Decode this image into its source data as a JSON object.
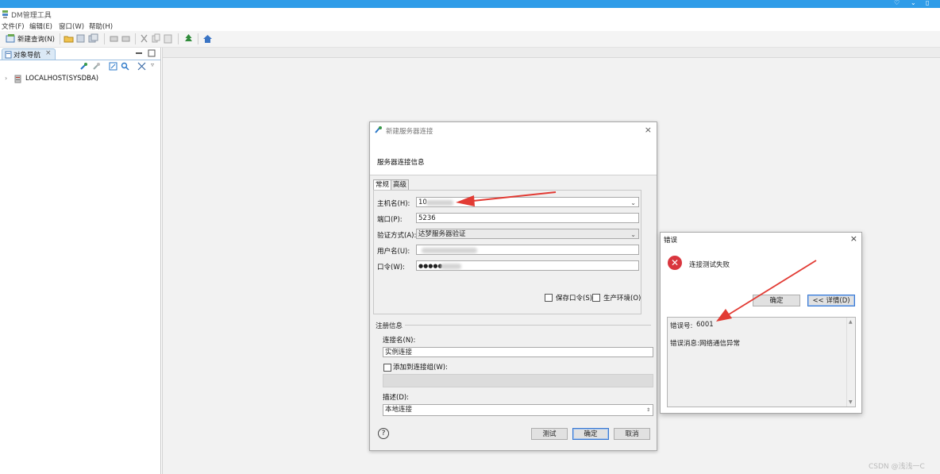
{
  "app": {
    "title": "DM管理工具"
  },
  "menu": [
    "文件(F)",
    "编辑(E)",
    "窗口(W)",
    "帮助(H)"
  ],
  "toolbar": {
    "new_query_label": "新建查询(N)"
  },
  "navigator": {
    "tab_label": "对象导航",
    "tree": [
      {
        "label": "LOCALHOST(SYSDBA)"
      }
    ]
  },
  "connect_dialog": {
    "title": "新建服务器连接",
    "header": "服务器连接信息",
    "tabs": [
      "常规",
      "高级"
    ],
    "host_label": "主机名(H):",
    "host_value": "10",
    "port_label": "端口(P):",
    "port_value": "5236",
    "auth_label": "验证方式(A):",
    "auth_value": "达梦服务器验证",
    "user_label": "用户名(U):",
    "password_label": "口令(W):",
    "password_value": "●●●●●",
    "save_password_label": "保存口令(S)",
    "production_label": "生产环境(O)",
    "reg_group_label": "注册信息",
    "conn_name_label": "连接名(N):",
    "conn_name_value": "实例连接",
    "add_group_label": "添加到连接组(W):",
    "desc_label": "描述(D):",
    "desc_value": "本地连接",
    "help_glyph": "?",
    "test_button": "测试",
    "ok_button": "确定",
    "cancel_button": "取消"
  },
  "error_dialog": {
    "title": "错误",
    "message": "连接测试失败",
    "ok_button": "确定",
    "details_button": "<< 详情(D)",
    "error_code_label": "错误号:",
    "error_code_value": "6001",
    "error_msg_label": "错误消息:",
    "error_msg_value": "网络通信异常"
  },
  "watermark": "CSDN @浅浅一C",
  "colors": {
    "accent": "#2f9ce8",
    "arrow": "#e23b34",
    "error_icon": "#d9363e"
  }
}
